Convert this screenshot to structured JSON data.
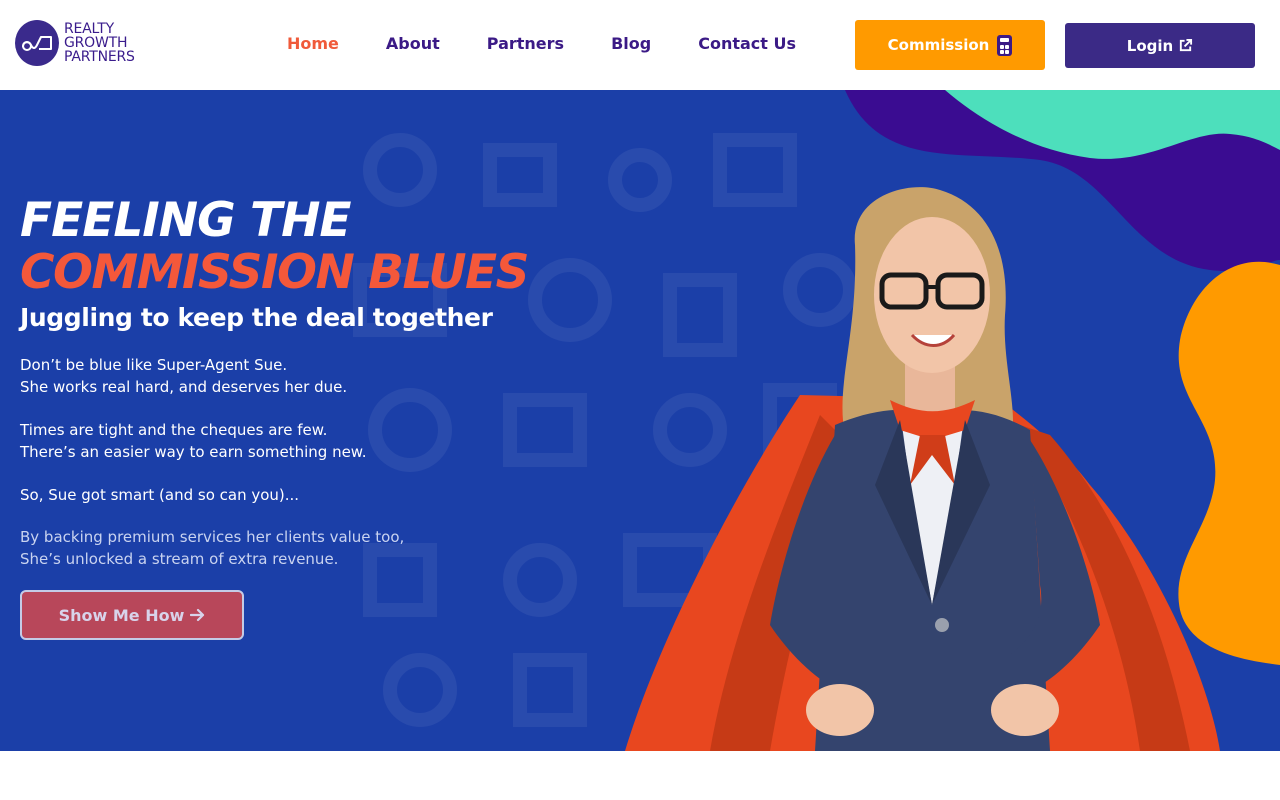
{
  "brand": {
    "logo_lines": [
      "REALTY",
      "GROWTH",
      "PARTNERS"
    ]
  },
  "nav": {
    "items": [
      {
        "label": "Home",
        "active": true
      },
      {
        "label": "About",
        "active": false
      },
      {
        "label": "Partners",
        "active": false
      },
      {
        "label": "Blog",
        "active": false
      },
      {
        "label": "Contact Us",
        "active": false
      }
    ]
  },
  "actions": {
    "commission_label": "Commission",
    "commission_icon": "calculator-icon",
    "login_label": "Login",
    "login_icon": "external-link-icon"
  },
  "hero": {
    "title_line1": "FEELING THE",
    "title_line2": "COMMISSION BLUES",
    "subtitle": "Juggling to keep the deal together",
    "paragraphs": [
      [
        "Don’t be blue like Super-Agent Sue.",
        "She works real hard, and deserves her due."
      ],
      [
        "Times are tight and the cheques are few.",
        "There’s an easier way to earn something new."
      ],
      [
        "So, Sue got smart (and so can you)..."
      ],
      [
        "By backing premium services her clients value too,",
        "She’s unlocked a stream of extra revenue."
      ]
    ],
    "cta_label": "Show Me How",
    "cta_icon": "arrow-right-icon"
  },
  "colors": {
    "brand_purple": "#3b1a86",
    "accent_orange": "#ff9a00",
    "accent_coral": "#f4583a",
    "hero_blue": "#1b3fa8",
    "teal": "#4ddfbc"
  }
}
